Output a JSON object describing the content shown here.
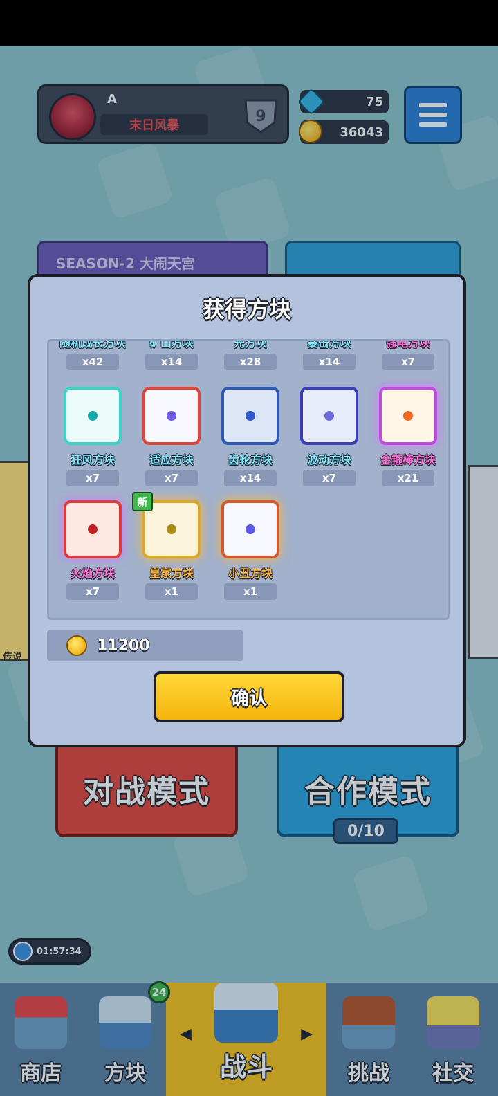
{
  "colors": {
    "title_white": "#ffffff",
    "name_cyan": "#7fe7ff",
    "name_magenta": "#ff6fd8",
    "name_orange": "#ffb43a",
    "confirm_yellow": "#f5b40c"
  },
  "profile": {
    "name": "A",
    "title": "末日风暴",
    "rank": "9",
    "gems": "75",
    "coins": "36043"
  },
  "banners": {
    "season": "SEASON-2 大闹天宫"
  },
  "modes": {
    "battle": "对战模式",
    "coop": "合作模式",
    "coop_count": "0/10"
  },
  "side": {
    "legend": "传说"
  },
  "timer": "01:57:34",
  "nav": {
    "shop": "商店",
    "blocks": "方块",
    "blocks_badge": "24",
    "battle": "战斗",
    "challenge": "挑战",
    "social": "社交"
  },
  "dialog": {
    "title": "获得方块",
    "partial_row": [
      {
        "name": "随机成长方块",
        "count": "x42"
      },
      {
        "name": "矿山方块",
        "count": "x14"
      },
      {
        "name": "光方块",
        "count": "x28"
      },
      {
        "name": "暴击方块",
        "count": "x14"
      },
      {
        "name": "强电方块",
        "count": "x7"
      }
    ],
    "blocks": [
      {
        "name": "狂风方块",
        "count": "x7"
      },
      {
        "name": "适应方块",
        "count": "x7"
      },
      {
        "name": "齿轮方块",
        "count": "x14"
      },
      {
        "name": "波动方块",
        "count": "x7"
      },
      {
        "name": "金箍棒方块",
        "count": "x21"
      },
      {
        "name": "火焰方块",
        "count": "x7"
      },
      {
        "name": "皇家方块",
        "count": "x1",
        "new_tag": "新"
      },
      {
        "name": "小丑方块",
        "count": "x1"
      }
    ],
    "gold_reward": "11200",
    "confirm": "确认"
  }
}
